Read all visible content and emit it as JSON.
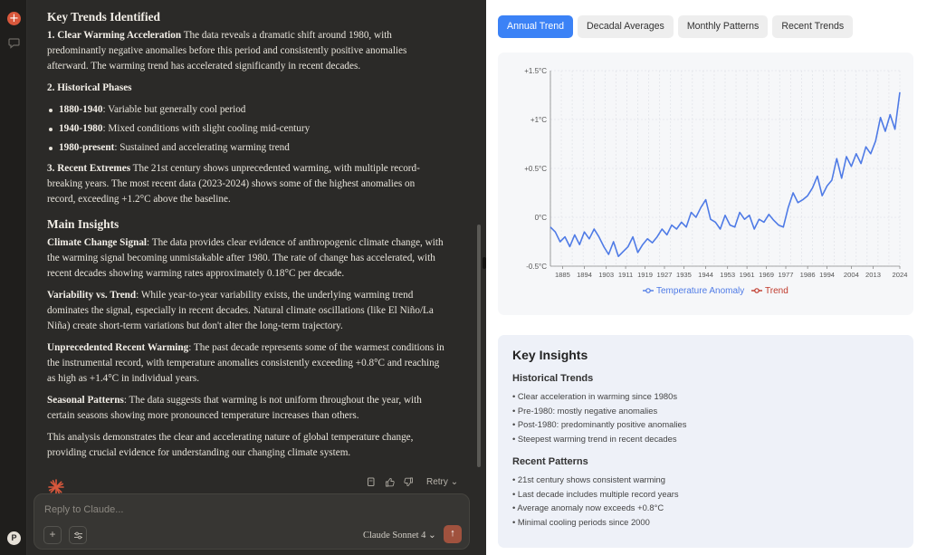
{
  "rail": {
    "avatar_initial": "P"
  },
  "message": {
    "heading_trends": "Key Trends Identified",
    "p1_strong": "1. Clear Warming Acceleration",
    "p1_text": " The data reveals a dramatic shift around 1980, with predominantly negative anomalies before this period and consistently positive anomalies afterward. The warming trend has accelerated significantly in recent decades.",
    "p2_strong": "2. Historical Phases",
    "phases": [
      {
        "period": "1880-1940",
        "desc": ": Variable but generally cool period"
      },
      {
        "period": "1940-1980",
        "desc": ": Mixed conditions with slight cooling mid-century"
      },
      {
        "period": "1980-present",
        "desc": ": Sustained and accelerating warming trend"
      }
    ],
    "p3_strong": "3. Recent Extremes",
    "p3_text": " The 21st century shows unprecedented warming, with multiple record-breaking years. The most recent data (2023-2024) shows some of the highest anomalies on record, exceeding +1.2°C above the baseline.",
    "heading_insights": "Main Insights",
    "insights": [
      {
        "title": "Climate Change Signal",
        "text": ": The data provides clear evidence of anthropogenic climate change, with the warming signal becoming unmistakable after 1980. The rate of change has accelerated, with recent decades showing warming rates approximately 0.18°C per decade."
      },
      {
        "title": "Variability vs. Trend",
        "text": ": While year-to-year variability exists, the underlying warming trend dominates the signal, especially in recent decades. Natural climate oscillations (like El Niño/La Niña) create short-term variations but don't alter the long-term trajectory."
      },
      {
        "title": "Unprecedented Recent Warming",
        "text": ": The past decade represents some of the warmest conditions in the instrumental record, with temperature anomalies consistently exceeding +0.8°C and reaching as high as +1.4°C in individual years."
      },
      {
        "title": "Seasonal Patterns",
        "text": ": The data suggests that warming is not uniform throughout the year, with certain seasons showing more pronounced temperature increases than others."
      }
    ],
    "closing": "This analysis demonstrates the clear and accelerating nature of global temperature change, providing crucial evidence for understanding our changing climate system.",
    "retry_label": "Retry"
  },
  "composer": {
    "placeholder": "Reply to Claude...",
    "model_label": "Claude Sonnet 4"
  },
  "panel": {
    "tabs": [
      {
        "label": "Annual Trend",
        "active": true
      },
      {
        "label": "Decadal Averages",
        "active": false
      },
      {
        "label": "Monthly Patterns",
        "active": false
      },
      {
        "label": "Recent Trends",
        "active": false
      }
    ],
    "key_insights": {
      "title": "Key Insights",
      "historical_title": "Historical Trends",
      "historical": [
        "Clear acceleration in warming since 1980s",
        "Pre-1980: mostly negative anomalies",
        "Post-1980: predominantly positive anomalies",
        "Steepest warming trend in recent decades"
      ],
      "recent_title": "Recent Patterns",
      "recent": [
        "21st century shows consistent warming",
        "Last decade includes multiple record years",
        "Average anomaly now exceeds +0.8°C",
        "Minimal cooling periods since 2000"
      ]
    }
  },
  "chart_data": {
    "type": "line",
    "title": "",
    "xlabel": "",
    "ylabel": "",
    "ylim": [
      -0.5,
      1.5
    ],
    "xlim": [
      1880,
      2024
    ],
    "y_ticks": [
      "-0.5°C",
      "0°C",
      "+0.5°C",
      "+1°C",
      "+1.5°C"
    ],
    "y_tick_values": [
      -0.5,
      0,
      0.5,
      1,
      1.5
    ],
    "x_ticks": [
      "1885",
      "1894",
      "1903",
      "1911",
      "1919",
      "1927",
      "1935",
      "1944",
      "1953",
      "1961",
      "1969",
      "1977",
      "1986",
      "1994",
      "2004",
      "2013",
      "2024"
    ],
    "x_tick_values": [
      1885,
      1894,
      1903,
      1911,
      1919,
      1927,
      1935,
      1944,
      1953,
      1961,
      1969,
      1977,
      1986,
      1994,
      2004,
      2013,
      2024
    ],
    "grid": true,
    "legend_placement": "bottom-center",
    "series": [
      {
        "name": "Temperature Anomaly",
        "color": "#4f7be6",
        "x": [
          1880,
          1882,
          1884,
          1886,
          1888,
          1890,
          1892,
          1894,
          1896,
          1898,
          1900,
          1902,
          1904,
          1906,
          1908,
          1910,
          1912,
          1914,
          1916,
          1918,
          1920,
          1922,
          1924,
          1926,
          1928,
          1930,
          1932,
          1934,
          1936,
          1938,
          1940,
          1942,
          1944,
          1946,
          1948,
          1950,
          1952,
          1954,
          1956,
          1958,
          1960,
          1962,
          1964,
          1966,
          1968,
          1970,
          1972,
          1974,
          1976,
          1978,
          1980,
          1982,
          1984,
          1986,
          1988,
          1990,
          1992,
          1994,
          1996,
          1998,
          2000,
          2002,
          2004,
          2006,
          2008,
          2010,
          2012,
          2014,
          2016,
          2018,
          2020,
          2022,
          2024
        ],
        "values": [
          -0.1,
          -0.15,
          -0.25,
          -0.2,
          -0.3,
          -0.18,
          -0.28,
          -0.15,
          -0.22,
          -0.12,
          -0.2,
          -0.3,
          -0.38,
          -0.25,
          -0.4,
          -0.35,
          -0.3,
          -0.2,
          -0.36,
          -0.28,
          -0.22,
          -0.26,
          -0.2,
          -0.12,
          -0.18,
          -0.08,
          -0.12,
          -0.05,
          -0.1,
          0.05,
          0.0,
          0.1,
          0.18,
          -0.02,
          -0.05,
          -0.12,
          0.02,
          -0.08,
          -0.1,
          0.05,
          -0.02,
          0.02,
          -0.12,
          -0.02,
          -0.05,
          0.03,
          -0.03,
          -0.08,
          -0.1,
          0.1,
          0.25,
          0.15,
          0.18,
          0.22,
          0.3,
          0.42,
          0.22,
          0.32,
          0.38,
          0.6,
          0.4,
          0.62,
          0.52,
          0.65,
          0.55,
          0.72,
          0.65,
          0.78,
          1.02,
          0.88,
          1.05,
          0.9,
          1.28
        ]
      },
      {
        "name": "Trend",
        "color": "#c0392b",
        "x": [],
        "values": []
      }
    ]
  }
}
